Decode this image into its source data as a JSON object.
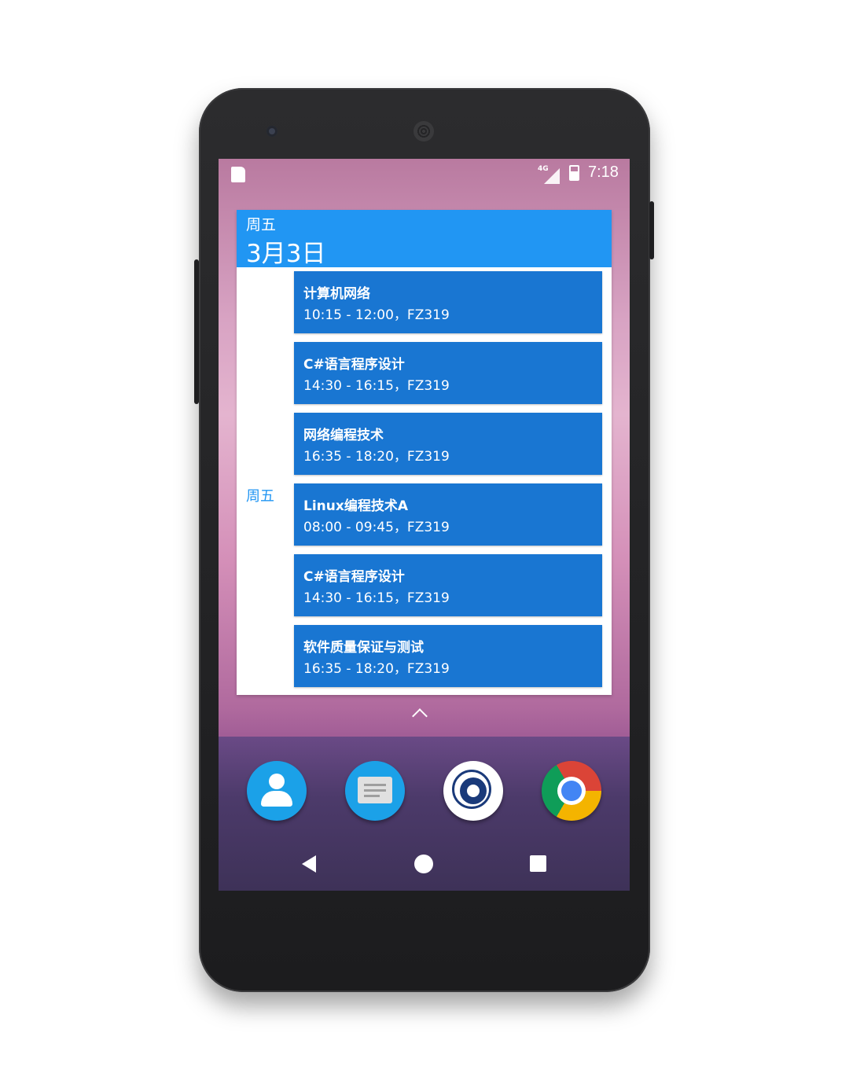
{
  "status_bar": {
    "network": "4G",
    "time": "7:18"
  },
  "widget": {
    "weekday": "周五",
    "date": "3月3日",
    "side_day_label": "周五",
    "events": [
      {
        "title": "计算机网络",
        "detail": "10:15 - 12:00，FZ319"
      },
      {
        "title": "C#语言程序设计",
        "detail": "14:30 - 16:15，FZ319"
      },
      {
        "title": "网络编程技术",
        "detail": "16:35 - 18:20，FZ319"
      },
      {
        "title": "Linux编程技术A",
        "detail": "08:00 - 09:45，FZ319"
      },
      {
        "title": "C#语言程序设计",
        "detail": "14:30 - 16:15，FZ319"
      },
      {
        "title": "软件质量保证与测试",
        "detail": "16:35 - 18:20，FZ319"
      }
    ]
  },
  "dock": {
    "icons": [
      "contacts-icon",
      "messages-icon",
      "campus-app-icon",
      "chrome-icon"
    ]
  },
  "nav_bar": {
    "icons": [
      "back-icon",
      "home-icon",
      "recents-icon"
    ]
  },
  "colors": {
    "widget_header": "#2196f3",
    "event_card": "#1976d2",
    "accent_text": "#2196f3"
  }
}
